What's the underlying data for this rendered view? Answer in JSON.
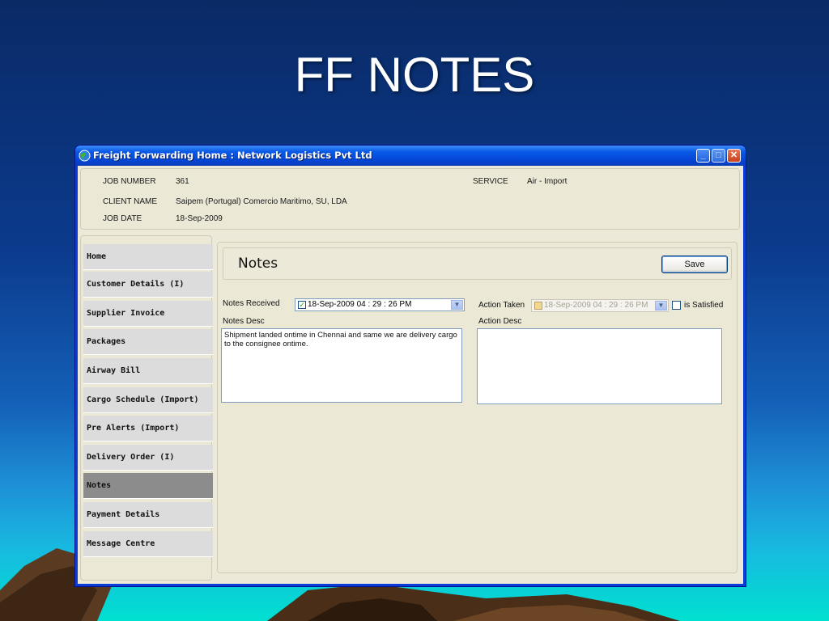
{
  "slide": {
    "title": "FF NOTES"
  },
  "window": {
    "title": "Freight Forwarding Home  :  Network Logistics Pvt Ltd",
    "minimize_glyph": "_",
    "maximize_glyph": "□",
    "close_glyph": "✕"
  },
  "job": {
    "job_number_label": "JOB NUMBER",
    "job_number": "361",
    "client_name_label": "CLIENT NAME",
    "client_name": "Saipem (Portugal) Comercio Maritimo, SU, LDA",
    "job_date_label": "JOB DATE",
    "job_date": "18-Sep-2009",
    "service_label": "SERVICE",
    "service": "Air - Import"
  },
  "sidebar": {
    "items": [
      {
        "label": "Home"
      },
      {
        "label": "Customer Details (I)"
      },
      {
        "label": "Supplier Invoice"
      },
      {
        "label": "Packages"
      },
      {
        "label": "Airway Bill"
      },
      {
        "label": "Cargo Schedule (Import)"
      },
      {
        "label": "Pre Alerts (Import)"
      },
      {
        "label": "Delivery Order (I)"
      },
      {
        "label": "Notes"
      },
      {
        "label": "Payment Details"
      },
      {
        "label": "Message Centre"
      }
    ],
    "active_index": 8
  },
  "notes": {
    "title": "Notes",
    "save_label": "Save",
    "notes_received_label": "Notes Received",
    "notes_received_value": "18-Sep-2009 04 : 29 : 26 PM",
    "notes_received_checked": true,
    "action_taken_label": "Action Taken",
    "action_taken_value": "18-Sep-2009 04 : 29 : 26 PM",
    "is_satisfied_label": "is Satisfied",
    "is_satisfied_checked": false,
    "notes_desc_label": "Notes Desc",
    "notes_desc_value": "Shipment landed ontime in Chennai and same we are delivery cargo to the consignee ontime.",
    "action_desc_label": "Action Desc",
    "action_desc_value": ""
  },
  "colors": {
    "active_nav": "#8c8c8c",
    "nav_bg": "#dcdcdc",
    "panel_bg": "#ece9d8",
    "titlebar": "#0547d8"
  }
}
